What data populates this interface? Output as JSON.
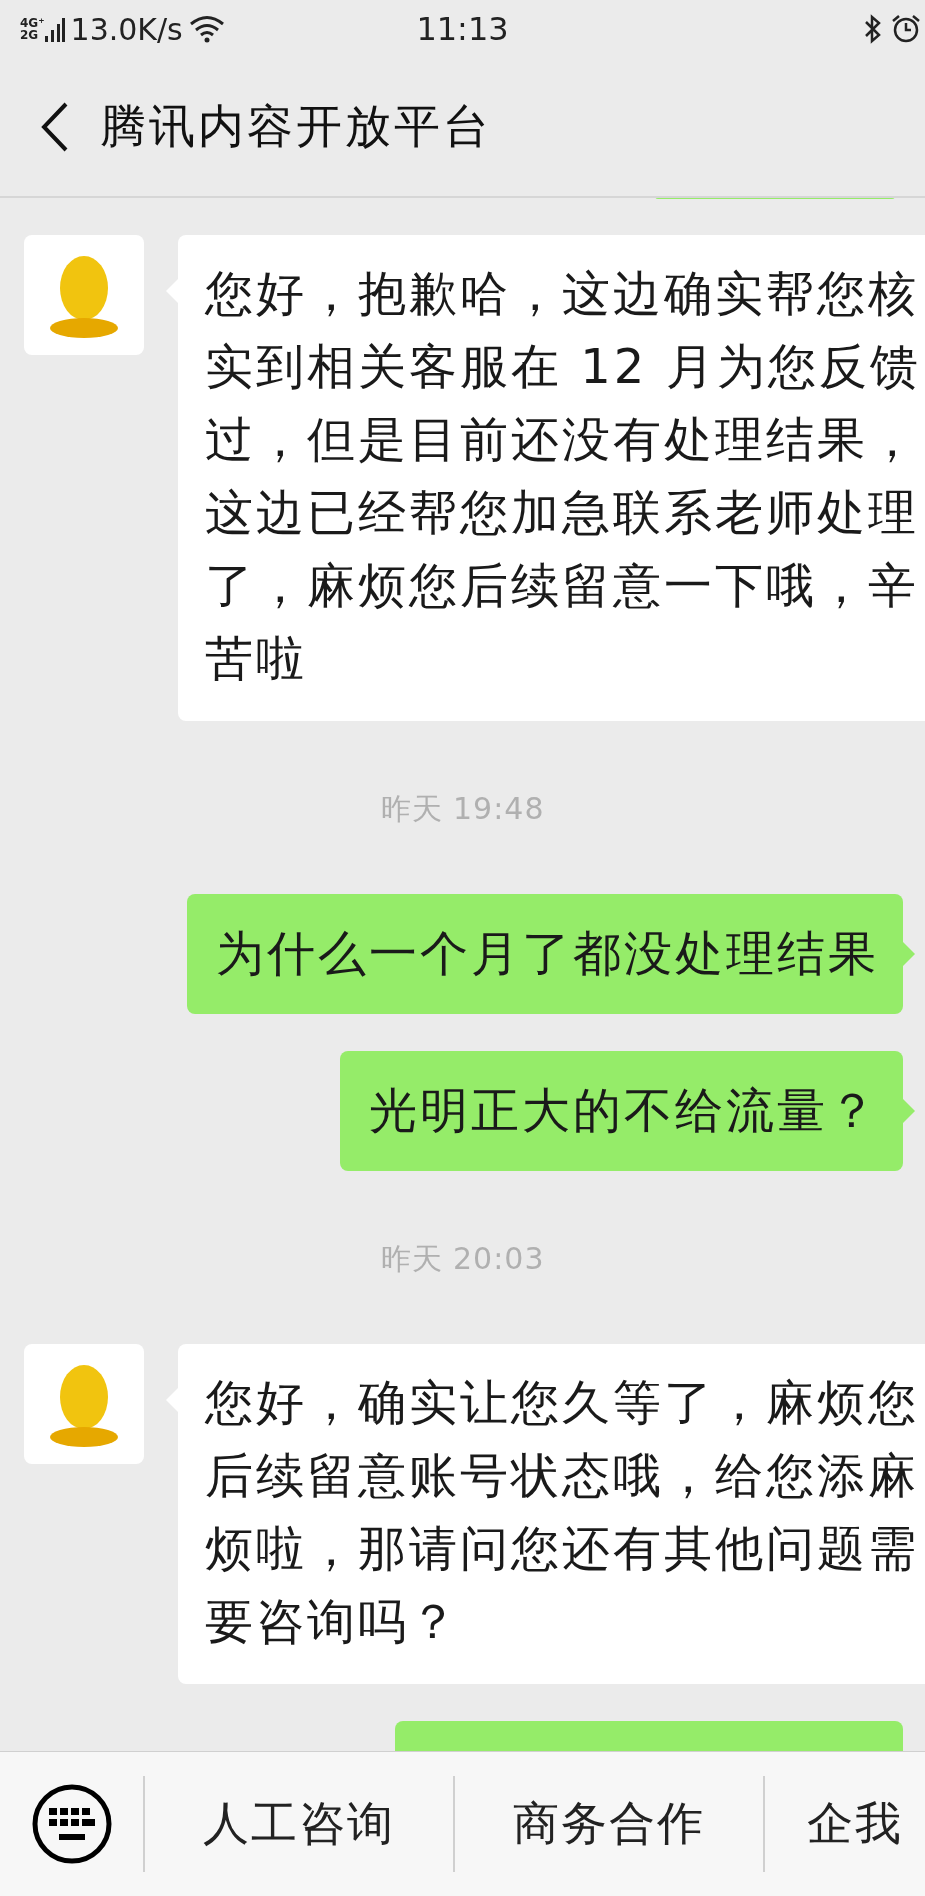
{
  "status_bar": {
    "network": [
      "4G⁺",
      "2G"
    ],
    "speed": "13.0K/s",
    "time": "11:13"
  },
  "header": {
    "title": "腾讯内容开放平台"
  },
  "messages": [
    {
      "kind": "sent_partial"
    },
    {
      "kind": "received",
      "lines": [
        "您好，抱歉哈，这边确实帮您核",
        "实到相关客服在 12 月为您反馈",
        "过，但是目前还没有处理结果，",
        "这边已经帮您加急联系老师处理",
        "了，麻烦您后续留意一下哦，辛",
        "苦啦"
      ]
    },
    {
      "kind": "time",
      "text": "昨天 19:48"
    },
    {
      "kind": "sent",
      "lines": [
        "为什么一个月了都没处理结果"
      ]
    },
    {
      "kind": "sent",
      "lines": [
        "光明正大的不给流量？"
      ]
    },
    {
      "kind": "time",
      "text": "昨天 20:03"
    },
    {
      "kind": "received",
      "lines": [
        "您好，确实让您久等了，麻烦您",
        "后续留意账号状态哦，给您添麻",
        "烦啦，那请问您还有其他问题需",
        "要咨询吗？"
      ]
    },
    {
      "kind": "sent_partial"
    }
  ],
  "bottom_menu": {
    "items": [
      "人工咨询",
      "商务合作",
      "企我"
    ]
  }
}
